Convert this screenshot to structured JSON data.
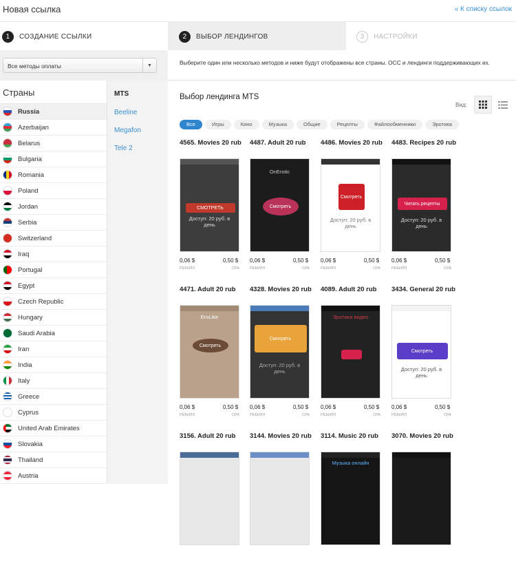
{
  "header": {
    "title": "Новая ссылка",
    "back_link": "« К списку ссылок"
  },
  "steps": [
    {
      "num": "1",
      "label": "СОЗДАНИЕ ССЫЛКИ"
    },
    {
      "num": "2",
      "label": "ВЫБОР ЛЕНДИНГОВ"
    },
    {
      "num": "3",
      "label": "НАСТРОЙКИ"
    }
  ],
  "payment_filter": {
    "value": "Все методы оплаты"
  },
  "hint": "Выберите один или несколько методов и ниже будут отображены все страны. ОСС и лендинги поддерживающих их.",
  "countries": {
    "heading": "Страны",
    "items": [
      "Russia",
      "Azerbaijan",
      "Belarus",
      "Bulgaria",
      "Romania",
      "Poland",
      "Jordan",
      "Serbia",
      "Switzerland",
      "Iraq",
      "Portugal",
      "Egypt",
      "Czech Republic",
      "Hungary",
      "Saudi Arabia",
      "Iran",
      "India",
      "Italy",
      "Greece",
      "Cyprus",
      "United Arab Emirates",
      "Slovakia",
      "Thailand",
      "Austria"
    ]
  },
  "operators": {
    "items": [
      "MTS",
      "Beeline",
      "Megafon",
      "Tele 2"
    ]
  },
  "main": {
    "heading": "Выбор лендинга MTS",
    "view_label": "Вид:",
    "tags": [
      "Все",
      "Игры",
      "Кино",
      "Музыка",
      "Общие",
      "Рецепты",
      "Файлообменники",
      "Эротика"
    ]
  },
  "labels": {
    "rebill": "РЕБИЛЛ",
    "cpa": "CPA"
  },
  "landings": [
    {
      "title": "4565. Movies 20 rub",
      "rebill": "0,06 $",
      "cpa": "0,50 $",
      "button": "СМОТРЕТЬ",
      "text": "Доступ: 20 руб. в день"
    },
    {
      "title": "4487. Adult 20 rub",
      "rebill": "0,06 $",
      "cpa": "0,50 $",
      "button": "Смотреть",
      "text": "OnErotic"
    },
    {
      "title": "4486. Movies 20 rub",
      "rebill": "0,06 $",
      "cpa": "0,50 $",
      "button": "Смотреть",
      "text": "Доступ: 20 руб. в день"
    },
    {
      "title": "4483. Recipes 20 rub",
      "rebill": "0,06 $",
      "cpa": "0,50 $",
      "button": "Читать рецепты",
      "text": "Доступ: 20 руб. в день"
    },
    {
      "title": "4471. Adult 20 rub",
      "rebill": "0,06 $",
      "cpa": "0,50 $",
      "button": "Смотреть",
      "text": "EroLike"
    },
    {
      "title": "4328. Movies 20 rub",
      "rebill": "0,06 $",
      "cpa": "0,50 $",
      "button": "Смотреть",
      "text": "Доступ: 20 руб. в день"
    },
    {
      "title": "4089. Adult 20 rub",
      "rebill": "0,06 $",
      "cpa": "0,50 $",
      "button": "",
      "text": "Эротика видео"
    },
    {
      "title": "3434. General 20 rub",
      "rebill": "0,06 $",
      "cpa": "0,50 $",
      "button": "Смотреть",
      "text": "Доступ: 20 руб. в день"
    },
    {
      "title": "3156. Adult 20 rub"
    },
    {
      "title": "3144. Movies 20 rub"
    },
    {
      "title": "3114. Music 20 rub",
      "text": "Музыка онлайн"
    },
    {
      "title": "3070. Movies 20 rub"
    }
  ],
  "colors": {
    "accent": "#2f86cf",
    "link": "#3a8fd0",
    "active_bg": "#f0f0f0"
  }
}
